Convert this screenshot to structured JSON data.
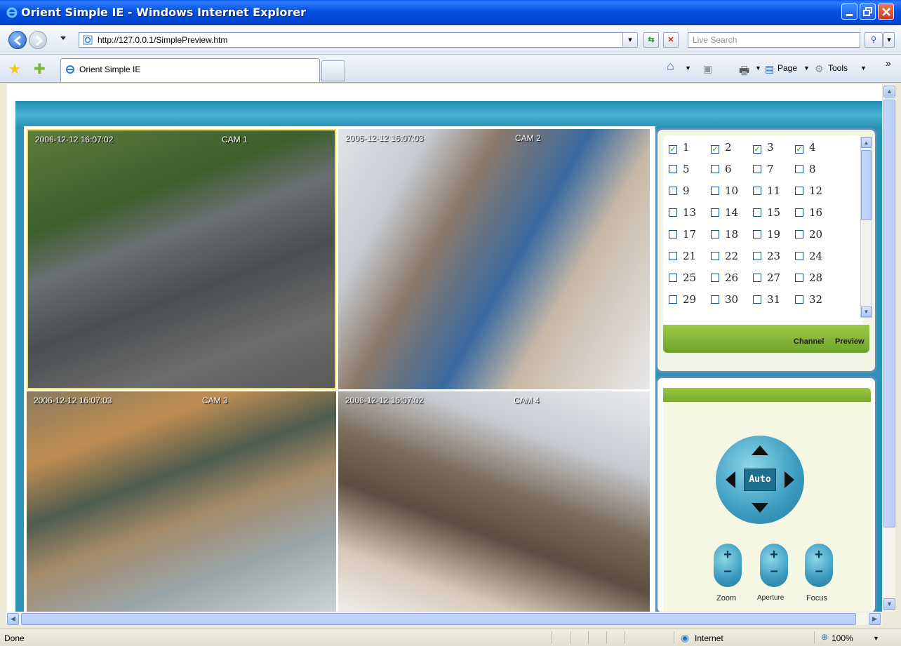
{
  "window": {
    "title": "Orient Simple IE - Windows Internet Explorer"
  },
  "address_bar": {
    "url": "http://127.0.0.1/SimplePreview.htm",
    "search_placeholder": "Live Search"
  },
  "tabs": [
    {
      "label": "Orient Simple IE"
    }
  ],
  "command_bar": {
    "page": "Page",
    "tools": "Tools"
  },
  "cameras": [
    {
      "timestamp": "2006-12-12 16:07:02",
      "label": "CAM 1"
    },
    {
      "timestamp": "2006-12-12 16:07:03",
      "label": "CAM 2"
    },
    {
      "timestamp": "2006-12-12 16:07:03",
      "label": "CAM 3"
    },
    {
      "timestamp": "2006-12-12 16:07:02",
      "label": "CAM 4"
    }
  ],
  "channel_panel": {
    "channels": [
      [
        "1",
        "2",
        "3",
        "4"
      ],
      [
        "5",
        "6",
        "7",
        "8"
      ],
      [
        "9",
        "10",
        "11",
        "12"
      ],
      [
        "13",
        "14",
        "15",
        "16"
      ],
      [
        "17",
        "18",
        "19",
        "20"
      ],
      [
        "21",
        "22",
        "23",
        "24"
      ],
      [
        "25",
        "26",
        "27",
        "28"
      ],
      [
        "29",
        "30",
        "31",
        "32"
      ]
    ],
    "checked": [
      "1",
      "2",
      "3",
      "4"
    ],
    "bar_label_1": "Channel",
    "bar_label_2": "Preview"
  },
  "ptz": {
    "auto_label": "Auto",
    "zoom_label": "Zoom",
    "aperture_label": "Aperture",
    "focus_label": "Focus"
  },
  "status_bar": {
    "text": "Done",
    "zone": "Internet",
    "zoom": "100%"
  },
  "colors": {
    "titlebar": "#0551e0",
    "banner": "#2b93b5",
    "highlight_border": "#f3e35a",
    "panel_border": "#5c8db6",
    "green_bar": "#7fb236"
  }
}
